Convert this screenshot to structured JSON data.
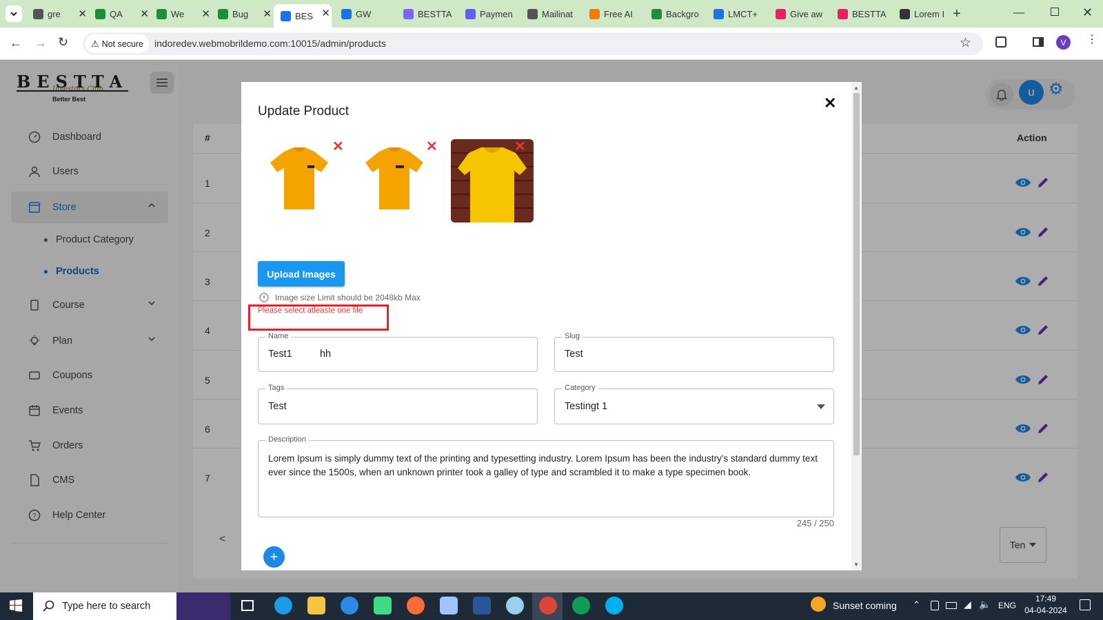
{
  "browser": {
    "tabs": [
      {
        "label": "gre",
        "color": "#555"
      },
      {
        "label": "QA",
        "color": "#1e8e3e"
      },
      {
        "label": "We",
        "color": "#1e8e3e"
      },
      {
        "label": "Bug",
        "color": "#1e8e3e"
      },
      {
        "label": "BES",
        "color": "#1a73e8"
      },
      {
        "label": "GW",
        "color": "#1a73e8"
      },
      {
        "label": "BESTTA",
        "color": "#7b61ff"
      },
      {
        "label": "Paymen",
        "color": "#635bff"
      },
      {
        "label": "Mailinat",
        "color": "#555"
      },
      {
        "label": "Free AI",
        "color": "#f57c00"
      },
      {
        "label": "Backgro",
        "color": "#1e8e3e"
      },
      {
        "label": "LMCT+",
        "color": "#1a73e8"
      },
      {
        "label": "Give aw",
        "color": "#e91e63"
      },
      {
        "label": "BESTTA",
        "color": "#e91e63"
      },
      {
        "label": "Lorem I",
        "color": "#333"
      }
    ],
    "security_label": "Not secure",
    "url": "indoredev.webmobrildemo.com:10015/admin/products",
    "profile_initial": "V"
  },
  "brand": {
    "name": "BESTTA",
    "tagline": "Investors Club",
    "slogan": "Better Best"
  },
  "sidebar": {
    "items": [
      {
        "label": "Dashboard",
        "icon": "dashboard-icon"
      },
      {
        "label": "Users",
        "icon": "user-icon"
      },
      {
        "label": "Store",
        "icon": "store-icon"
      },
      {
        "label": "Course",
        "icon": "course-icon"
      },
      {
        "label": "Plan",
        "icon": "bulb-icon"
      },
      {
        "label": "Coupons",
        "icon": "coupon-icon"
      },
      {
        "label": "Events",
        "icon": "calendar-icon"
      },
      {
        "label": "Orders",
        "icon": "cart-icon"
      },
      {
        "label": "CMS",
        "icon": "document-icon"
      },
      {
        "label": "Help Center",
        "icon": "help-icon"
      }
    ],
    "store_sub": [
      "Product Category",
      "Products"
    ]
  },
  "header": {
    "avatar_initial": "u"
  },
  "table": {
    "col_hash": "#",
    "col_action": "Action",
    "rows": [
      "1",
      "2",
      "3",
      "4",
      "5",
      "6",
      "7"
    ],
    "pagination_prev": "<",
    "rows_per_page": "Ten"
  },
  "modal": {
    "title": "Update Product",
    "upload_button": "Upload Images",
    "size_hint": "Image size Limit should be 2048kb Max",
    "error": "Please select atleaste one file",
    "fields": {
      "name": {
        "label": "Name",
        "value": "Test1          hh"
      },
      "slug": {
        "label": "Slug",
        "value": "Test"
      },
      "tags": {
        "label": "Tags",
        "value": "Test"
      },
      "category": {
        "label": "Category",
        "value": "Testingt 1"
      },
      "description": {
        "label": "Description",
        "value": "Lorem Ipsum is simply dummy text of the printing and typesetting industry. Lorem Ipsum has been the industry's standard dummy text ever since the 1500s, when an unknown printer took a galley of type and scrambled it to make a type specimen book.",
        "counter": "245 / 250"
      }
    },
    "add_button": "+"
  },
  "taskbar": {
    "search_placeholder": "Type here to search",
    "weather": "Sunset coming",
    "language": "ENG",
    "time": "17:49",
    "date": "04-04-2024"
  },
  "colors": {
    "primary": "#1e88e5",
    "accent_purple": "#5e35b1",
    "error_red": "#e53935",
    "error_box": "#e0202a"
  }
}
